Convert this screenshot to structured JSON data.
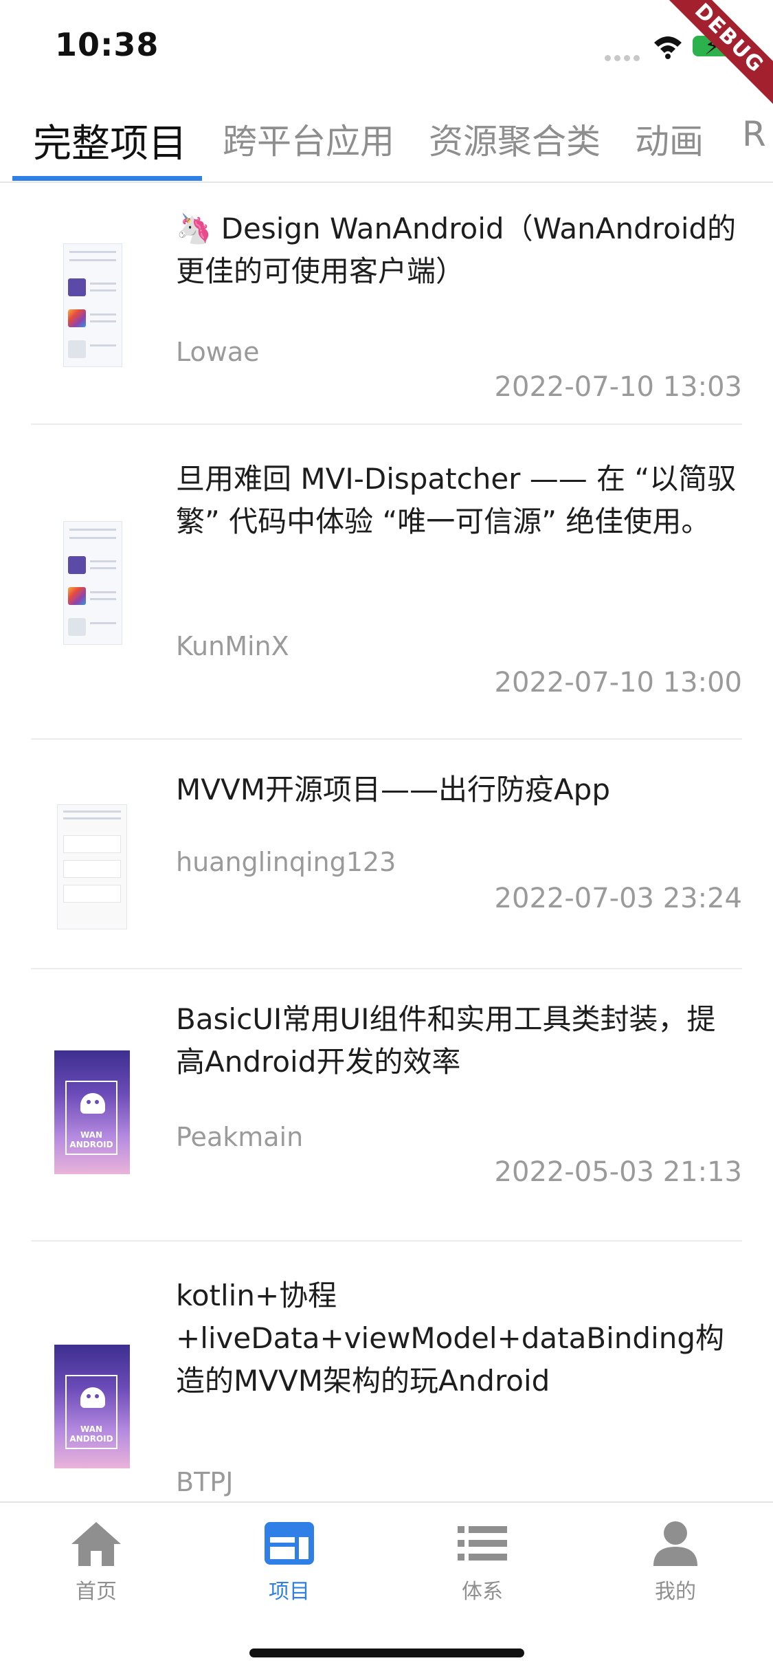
{
  "status": {
    "time": "10:38",
    "debug_badge": "DEBUG"
  },
  "tabs": [
    {
      "label": "完整项目",
      "active": true
    },
    {
      "label": "跨平台应用",
      "active": false
    },
    {
      "label": "资源聚合类",
      "active": false
    },
    {
      "label": "动画",
      "active": false
    },
    {
      "label": "R",
      "active": false
    }
  ],
  "items": [
    {
      "title": "🦄 Design WanAndroid（WanAndroid的更佳的可使用客户端）",
      "author": "Lowae",
      "date": "2022-07-10 13:03",
      "thumb": "app-screenshot"
    },
    {
      "title": "旦用难回 MVI-Dispatcher —— 在 “以简驭繁” 代码中体验 “唯一可信源” 绝佳使用。",
      "author": "KunMinX",
      "date": "2022-07-10 13:00",
      "thumb": "app-screenshot"
    },
    {
      "title": "MVVM开源项目——出行防疫App",
      "author": "huanglinqing123",
      "date": "2022-07-03 23:24",
      "thumb": "app-screenshot"
    },
    {
      "title": "BasicUI常用UI组件和实用工具类封装，提高Android开发的效率",
      "author": "Peakmain",
      "date": "2022-05-03 21:13",
      "thumb": "wan-android"
    },
    {
      "title": "kotlin+协程+liveData+viewModel+dataBinding构造的MVVM架构的玩Android",
      "author": "BTPJ",
      "date": "",
      "thumb": "wan-android"
    }
  ],
  "thumb_text": "WAN ANDROID",
  "nav": [
    {
      "label": "首页",
      "icon": "home-icon",
      "active": false
    },
    {
      "label": "项目",
      "icon": "projects-icon",
      "active": true
    },
    {
      "label": "体系",
      "icon": "list-icon",
      "active": false
    },
    {
      "label": "我的",
      "icon": "profile-icon",
      "active": false
    }
  ],
  "colors": {
    "accent": "#2f7fe6",
    "inactive": "#8f8f8f"
  }
}
